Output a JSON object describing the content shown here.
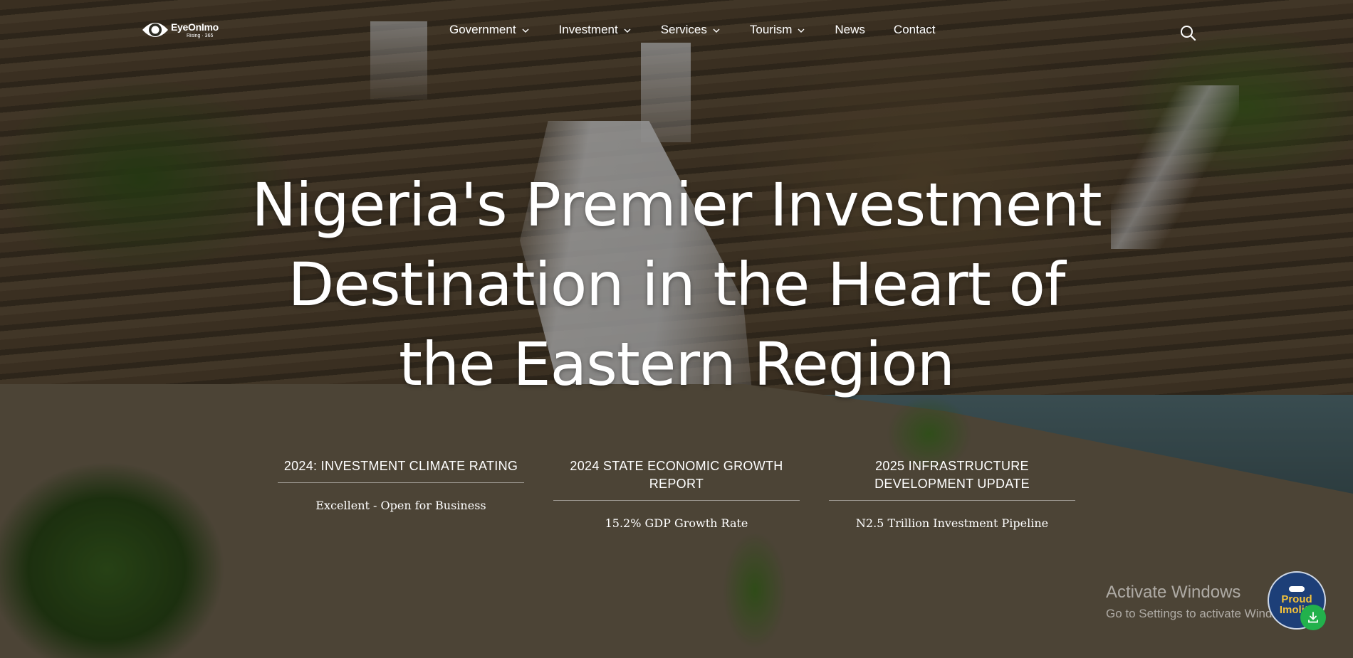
{
  "logo": {
    "name": "EyeOnImo",
    "tagline": "Rising · 365"
  },
  "nav": {
    "items": [
      {
        "label": "Government",
        "dropdown": true
      },
      {
        "label": "Investment",
        "dropdown": true
      },
      {
        "label": "Services",
        "dropdown": true
      },
      {
        "label": "Tourism",
        "dropdown": true
      },
      {
        "label": "News",
        "dropdown": false
      },
      {
        "label": "Contact",
        "dropdown": false
      }
    ],
    "chevron": "⌄",
    "search_icon": "search-icon"
  },
  "hero": {
    "line1": "Nigeria's Premier Investment",
    "line2": "Destination in the Heart of",
    "line3": "the Eastern Region"
  },
  "stats": [
    {
      "heading": "2024: INVESTMENT CLIMATE RATING",
      "value": "Excellent - Open for Business"
    },
    {
      "heading": "2024 STATE ECONOMIC GROWTH REPORT",
      "value": "15.2% GDP Growth Rate"
    },
    {
      "heading": "2025 INFRASTRUCTURE DEVELOPMENT UPDATE",
      "value": "N2.5 Trillion Investment Pipeline"
    }
  ],
  "watermark": {
    "title": "Activate Windows",
    "subtitle": "Go to Settings to activate Windows."
  },
  "badge": {
    "line1": "Proud",
    "line2": "Imolite"
  },
  "colors": {
    "badge_bg": "#1d3f78",
    "badge_text": "#f4c23a",
    "download_button": "#22b14c"
  }
}
